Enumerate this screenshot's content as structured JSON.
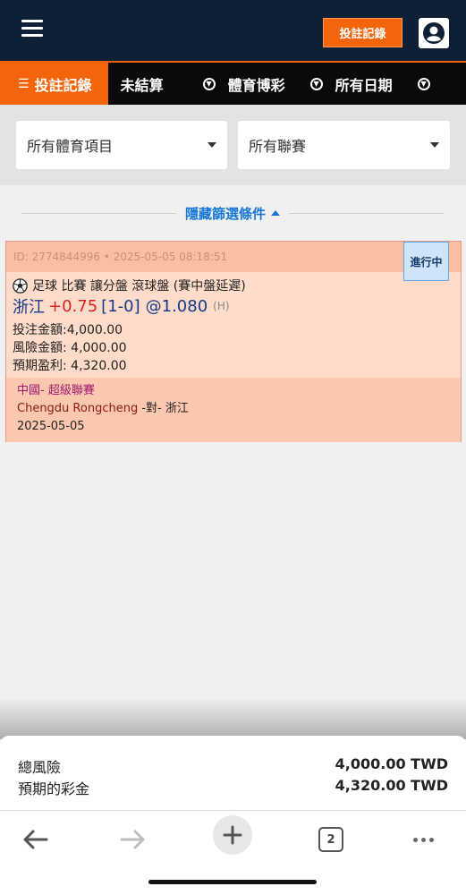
{
  "header": {
    "record_button": "投註記錄",
    "menu_icon": "hamburger-menu-icon",
    "avatar_icon": "user-account-icon"
  },
  "tabs": [
    {
      "label": "投註記錄",
      "icon": "list-icon",
      "active": true
    },
    {
      "label": "未結算",
      "icon": "",
      "active": false
    },
    {
      "label": "體育博彩",
      "icon": "dropdown-circle-icon",
      "active": false
    },
    {
      "label": "所有日期",
      "icon": "dropdown-circle-icon",
      "active": false
    }
  ],
  "filters": {
    "sport": "所有體育項目",
    "league": "所有聯賽",
    "toggle_label": "隱藏篩選條件"
  },
  "bet": {
    "id_line": "ID: 2774844996 • 2025-05-05 08:18:51",
    "status": "進行中",
    "desc": "足球 比賽  讓分盤 滾球盤 (賽中盤延遲)",
    "team": "浙江",
    "handicap": "+0.75",
    "score": "[1-0]",
    "odds": "@1.080",
    "odds_type": "(H)",
    "stake": "投注金額:4,000.00",
    "risk": "風險金額: 4,000.00",
    "profit": "預期盈利: 4,320.00",
    "league": "中國- 超級聯賽",
    "home": "Chengdu Rongcheng",
    "vs": " -對- 浙江",
    "date": "2025-05-05"
  },
  "summary": {
    "total_risk_label": "總風險",
    "total_risk_value": "4,000.00 TWD",
    "expected_label": "預期的彩金",
    "expected_value": "4,320.00 TWD"
  },
  "browser": {
    "tab_count": "2"
  },
  "colors": {
    "accent": "#f4640a",
    "header_bg": "#0f1f36",
    "link_blue": "#1478d4"
  }
}
